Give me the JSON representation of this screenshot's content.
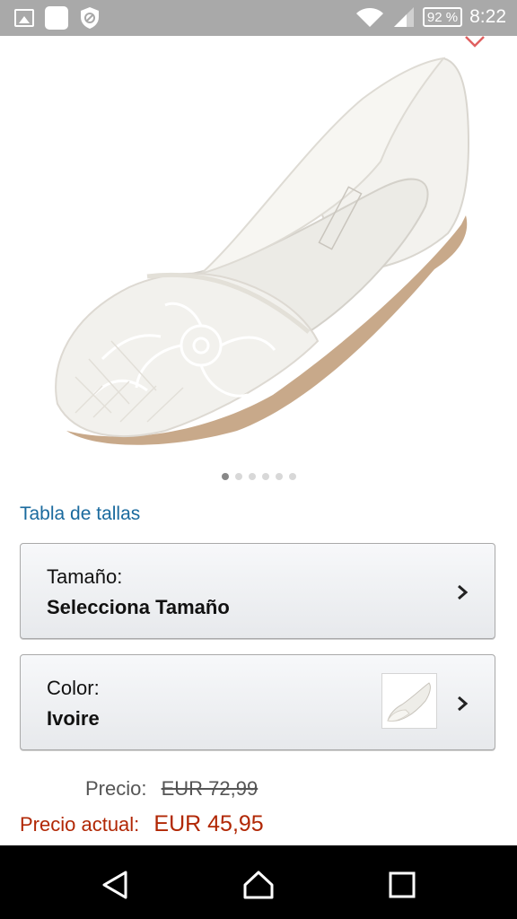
{
  "status_bar": {
    "battery": "92 %",
    "time": "8:22"
  },
  "product": {
    "image_count": 6,
    "active_image_index": 0
  },
  "size_chart_link": "Tabla de tallas",
  "size_selector": {
    "label": "Tamaño:",
    "value": "Selecciona Tamaño"
  },
  "color_selector": {
    "label": "Color:",
    "value": "Ivoire"
  },
  "pricing": {
    "list_label": "Precio:",
    "list_price": "EUR 72,99",
    "current_label": "Precio actual:",
    "current_price": "EUR 45,95"
  },
  "colors": {
    "link": "#1a6a9e",
    "price": "#b12704",
    "heart": "#e06060"
  }
}
